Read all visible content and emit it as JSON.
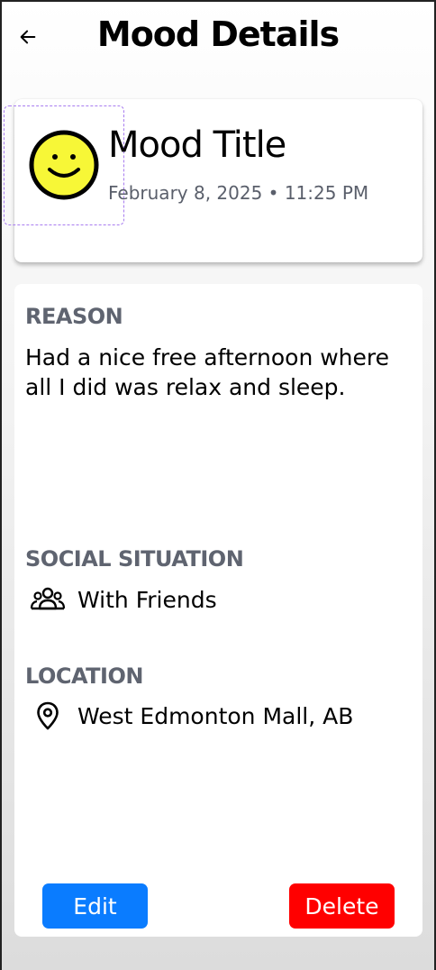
{
  "header": {
    "title": "Mood Details",
    "back_icon": "arrow-left-icon"
  },
  "mood": {
    "title": "Mood Title",
    "datetime": "February 8, 2025 • 11:25 PM",
    "emoji_icon": "smiley-face-icon",
    "emoji_color": "#f7f737"
  },
  "reason": {
    "label": "REASON",
    "text": "Had a nice free afternoon where all I did was relax and sleep."
  },
  "social": {
    "label": "SOCIAL SITUATION",
    "icon": "group-icon",
    "value": "With Friends"
  },
  "location": {
    "label": "LOCATION",
    "icon": "map-pin-icon",
    "value": "West Edmonton Mall, AB"
  },
  "actions": {
    "edit_label": "Edit",
    "edit_color": "#0a7cff",
    "delete_label": "Delete",
    "delete_color": "#ff0000"
  }
}
